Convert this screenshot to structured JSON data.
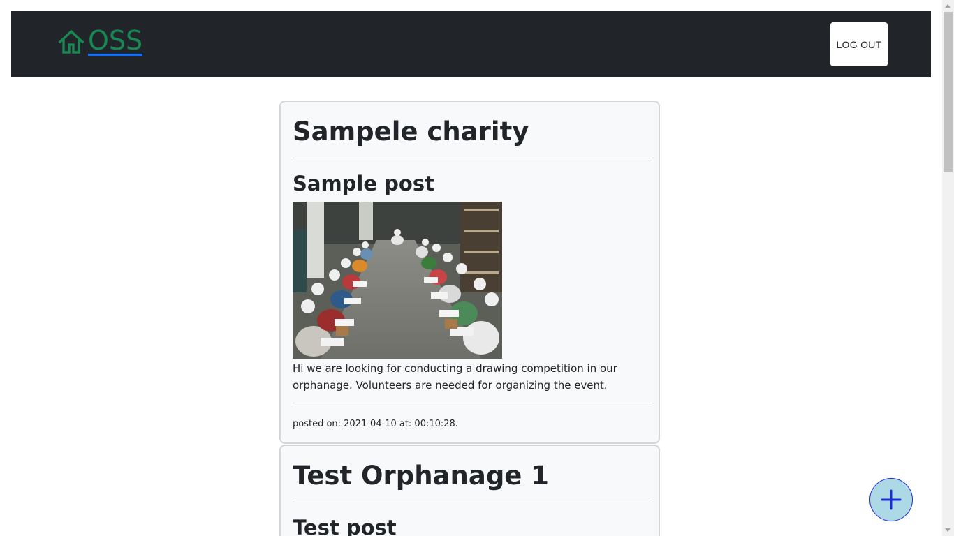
{
  "navbar": {
    "brand": "OSS",
    "brand_icon": "home-icon",
    "logout_label": "LOG OUT"
  },
  "posts": [
    {
      "org_name": "Sampele charity",
      "title": "Sample post",
      "image_alt": "children-reading-photo",
      "body": "Hi we are looking for conducting a drawing competition in our orphanage. Volunteers are needed for organizing the event.",
      "meta": "posted on: 2021-04-10 at: 00:10:28."
    },
    {
      "org_name": "Test Orphanage 1",
      "title": "Test post"
    }
  ],
  "fab": {
    "icon": "plus-icon"
  },
  "colors": {
    "navbar_bg": "#212529",
    "brand": "#198754",
    "brand_underline": "#0d6efd",
    "card_bg": "#f8f9fa",
    "fab_bg": "#add8e6",
    "fab_icon": "#1d2bd8"
  }
}
